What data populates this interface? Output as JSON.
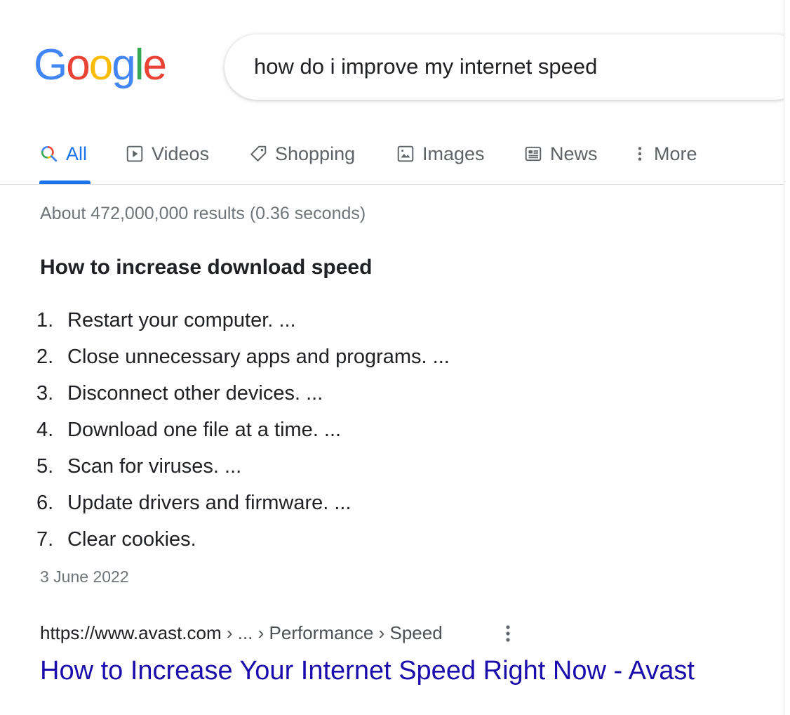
{
  "logo": {
    "letters": [
      {
        "char": "G",
        "color": "#4285F4"
      },
      {
        "char": "o",
        "color": "#EA4335"
      },
      {
        "char": "o",
        "color": "#FBBC05"
      },
      {
        "char": "g",
        "color": "#4285F4"
      },
      {
        "char": "l",
        "color": "#34A853"
      },
      {
        "char": "e",
        "color": "#EA4335"
      }
    ]
  },
  "search": {
    "query": "how do i improve my internet speed"
  },
  "tabs": [
    {
      "label": "All",
      "icon": "search-icon",
      "active": true
    },
    {
      "label": "Videos",
      "icon": "play-icon",
      "active": false
    },
    {
      "label": "Shopping",
      "icon": "tag-icon",
      "active": false
    },
    {
      "label": "Images",
      "icon": "image-icon",
      "active": false
    },
    {
      "label": "News",
      "icon": "news-icon",
      "active": false
    },
    {
      "label": "More",
      "icon": "more-vertical-icon",
      "active": false
    }
  ],
  "stats": "About 472,000,000 results (0.36 seconds)",
  "snippet": {
    "title": "How to increase download speed",
    "steps": [
      {
        "num": "1.",
        "text": "Restart your computer. ..."
      },
      {
        "num": "2.",
        "text": "Close unnecessary apps and programs. ..."
      },
      {
        "num": "3.",
        "text": "Disconnect other devices. ..."
      },
      {
        "num": "4.",
        "text": "Download one file at a time. ..."
      },
      {
        "num": "5.",
        "text": "Scan for viruses. ..."
      },
      {
        "num": "6.",
        "text": "Update drivers and firmware. ..."
      },
      {
        "num": "7.",
        "text": "Clear cookies."
      }
    ],
    "date": "3 June 2022"
  },
  "result": {
    "url": "https://www.avast.com",
    "breadcrumb": " › ... › Performance › Speed",
    "title": "How to Increase Your Internet Speed Right Now - Avast"
  },
  "colors": {
    "accent": "#1a73e8",
    "link": "#1a0dab",
    "muted": "#70757a"
  }
}
